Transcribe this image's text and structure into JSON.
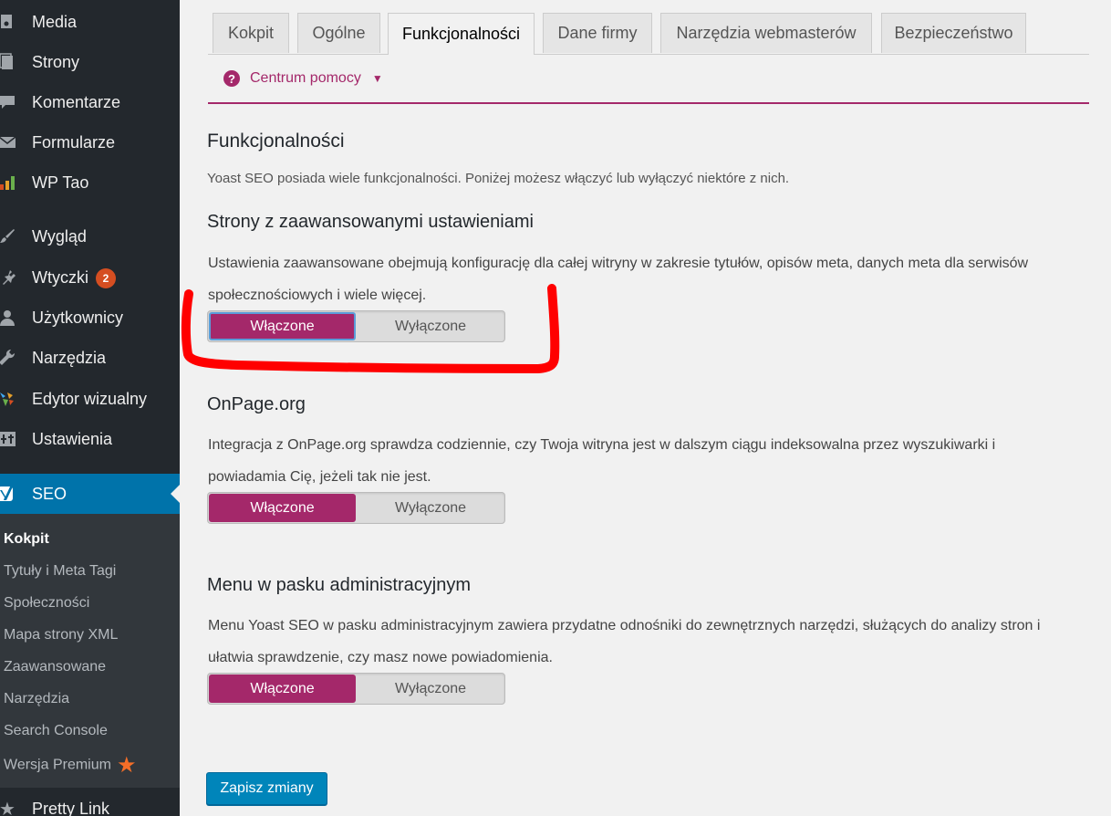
{
  "sidebar": {
    "items": [
      {
        "label": "Media",
        "icon": "media-icon"
      },
      {
        "label": "Strony",
        "icon": "pages-icon"
      },
      {
        "label": "Komentarze",
        "icon": "comments-icon"
      },
      {
        "label": "Formularze",
        "icon": "mail-icon"
      },
      {
        "label": "WP Tao",
        "icon": "bar-chart-icon"
      },
      {
        "label": "Wygląd",
        "icon": "brush-icon"
      },
      {
        "label": "Wtyczki",
        "icon": "plugin-icon",
        "badge": "2"
      },
      {
        "label": "Użytkownicy",
        "icon": "user-icon"
      },
      {
        "label": "Narzędzia",
        "icon": "wrench-icon"
      },
      {
        "label": "Edytor wizualny",
        "icon": "visual-editor-icon"
      },
      {
        "label": "Ustawienia",
        "icon": "settings-icon"
      }
    ],
    "seo": {
      "label": "SEO",
      "icon": "yoast-icon"
    },
    "submenu": [
      "Kokpit",
      "Tytuły i Meta Tagi",
      "Społeczności",
      "Mapa strony XML",
      "Zaawansowane",
      "Narzędzia",
      "Search Console",
      "Wersja Premium"
    ],
    "bottom_item": {
      "label": "Pretty Link",
      "icon": "star-icon"
    }
  },
  "tabs": [
    "Kokpit",
    "Ogólne",
    "Funkcjonalności",
    "Dane firmy",
    "Narzędzia webmasterów",
    "Bezpieczeństwo"
  ],
  "active_tab": "Funkcjonalności",
  "help": {
    "label": "Centrum pomocy"
  },
  "page": {
    "title": "Funkcjonalności",
    "intro": "Yoast SEO posiada wiele funkcjonalności. Poniżej możesz włączyć lub wyłączyć niektóre z nich."
  },
  "features": [
    {
      "title": "Strony z zaawansowanymi ustawieniami",
      "description": "Ustawienia zaawansowane obejmują konfigurację dla całej witryny w zakresie tytułów, opisów meta, danych meta dla serwisów społecznościowych i wiele więcej.",
      "on_label": "Włączone",
      "off_label": "Wyłączone",
      "state": "on"
    },
    {
      "title": "OnPage.org",
      "description": "Integracja z OnPage.org sprawdza codziennie, czy Twoja witryna jest w dalszym ciągu indeksowalna przez wyszukiwarki i powiadamia Cię, jeżeli tak nie jest.",
      "on_label": "Włączone",
      "off_label": "Wyłączone",
      "state": "on"
    },
    {
      "title": "Menu w pasku administracyjnym",
      "description": "Menu Yoast SEO w pasku administracyjnym zawiera przydatne odnośniki do zewnętrznych narzędzi, służących do analizy stron i ułatwia sprawdzenie, czy masz nowe powiadomienia.",
      "on_label": "Włączone",
      "off_label": "Wyłączone",
      "state": "on"
    }
  ],
  "save_button": "Zapisz zmiany",
  "colors": {
    "accent": "#a4286a",
    "sidebar": "#23282d",
    "seo_active": "#0073aa",
    "button": "#0085ba",
    "annotation": "#ff0000"
  }
}
